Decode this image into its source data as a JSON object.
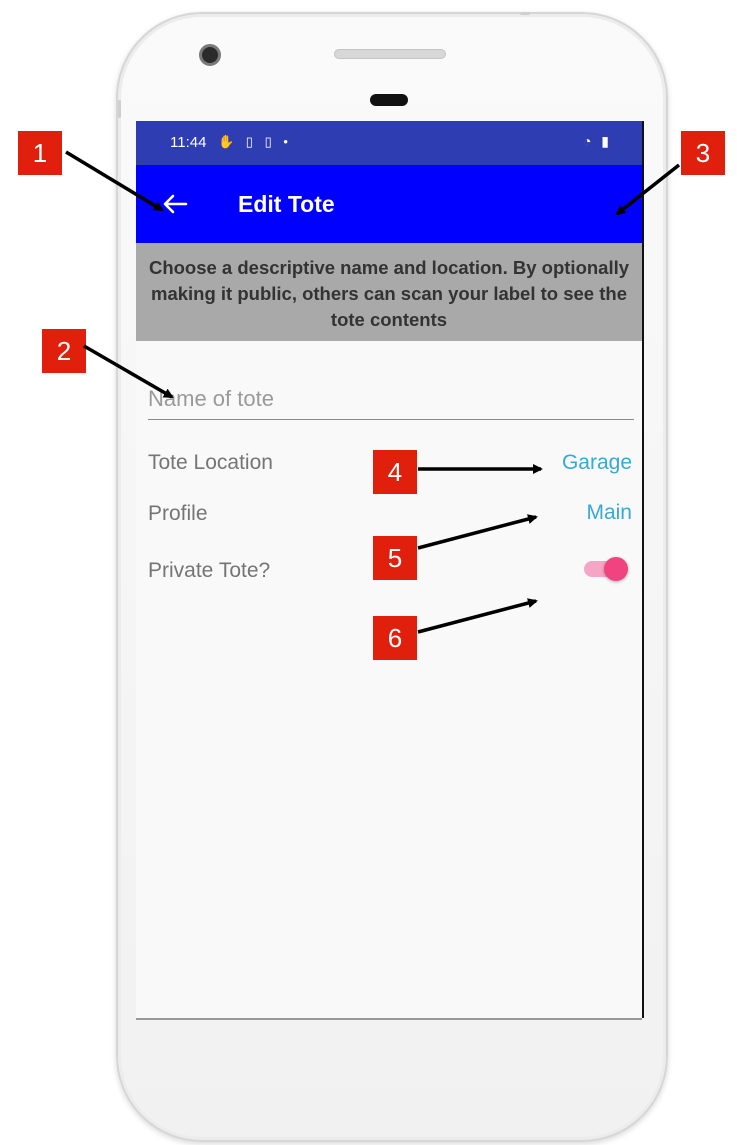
{
  "status_bar": {
    "time": "11:44",
    "left_icons": "✋ ▯ ▯  •",
    "right_icons": "◔ ▮"
  },
  "app_bar": {
    "title": "Edit Tote",
    "back_icon": "back-arrow-icon",
    "background": "#0000ff"
  },
  "banner": {
    "text": "Choose a descriptive name and location. By optionally making it public, others can scan your label to see the tote contents"
  },
  "form": {
    "name_placeholder": "Name of tote",
    "name_value": "",
    "location_label": "Tote Location",
    "location_value": "Garage",
    "profile_label": "Profile",
    "profile_value": "Main",
    "private_label": "Private Tote?",
    "private_enabled": true
  },
  "callouts": [
    "1",
    "2",
    "3",
    "4",
    "5",
    "6"
  ],
  "colors": {
    "status_bar": "#2f3db3",
    "accent_link": "#39a8d6",
    "toggle": "#f0437f",
    "callout": "#e0200c"
  }
}
